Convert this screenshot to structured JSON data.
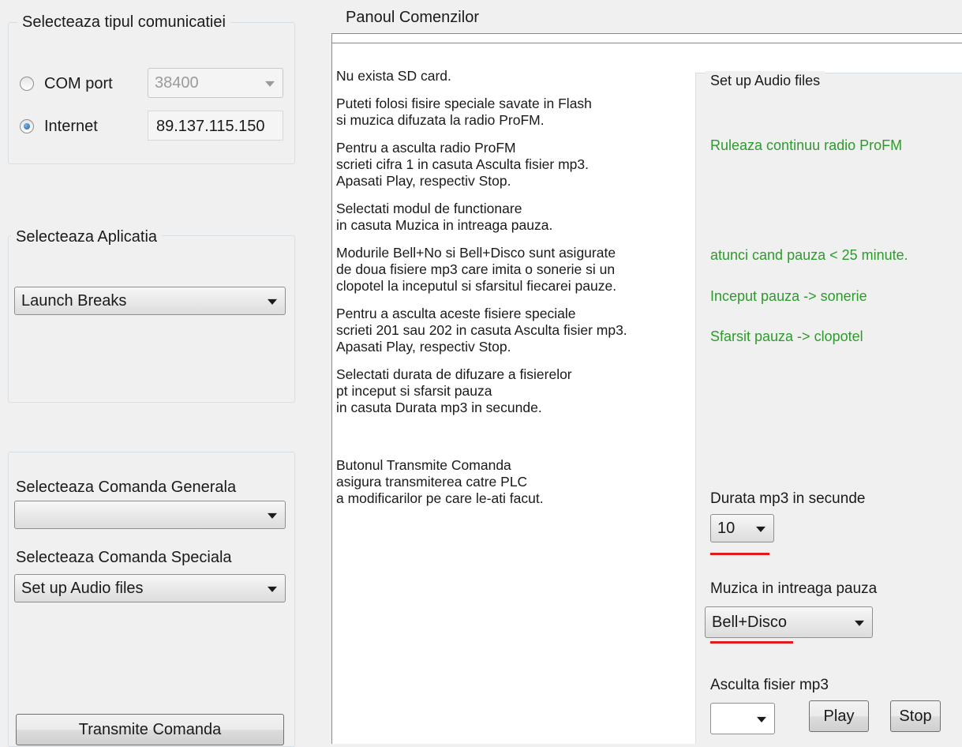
{
  "communication": {
    "title": "Selecteaza tipul comunicatiei",
    "com_port_label": "COM port",
    "com_port_value": "38400",
    "internet_label": "Internet",
    "internet_value": "89.137.115.150",
    "selected": "Internet"
  },
  "application": {
    "title": "Selecteaza Aplicatia",
    "selected": "Launch Breaks"
  },
  "commands": {
    "general_label": "Selecteaza Comanda Generala",
    "general_selected": "",
    "special_label": "Selecteaza Comanda Speciala",
    "special_selected": "Set up Audio files",
    "transmit_button": "Transmite Comanda"
  },
  "panel": {
    "title": "Panoul Comenzilor",
    "instructions": [
      "Nu exista SD card.",
      "Puteti folosi fisire speciale savate in Flash\nsi muzica difuzata la radio ProFM.",
      "Pentru a asculta radio ProFM\nscrieti cifra 1 in casuta Asculta fisier mp3.\nApasati Play, respectiv Stop.",
      "Selectati modul de functionare\nin casuta Muzica in intreaga pauza.",
      "Modurile Bell+No si Bell+Disco sunt asigurate\nde doua fisiere mp3 care imita o sonerie si un\nclopotel la inceputul si sfarsitul fiecarei pauze.",
      "Pentru a asculta aceste fisiere speciale\nscrieti 201 sau 202 in casuta Asculta fisier mp3.\nApasati Play, respectiv Stop.",
      "Selectati durata de difuzare a fisierelor\npt inceput si sfarsit pauza\nin casuta Durata mp3 in secunde.",
      "Butonul Transmite Comanda\nasigura transmiterea catre PLC\na modificarilor pe care le-ati facut."
    ]
  },
  "audio": {
    "title": "Set up Audio files",
    "status_radio": "Ruleaza continuu radio ProFM",
    "status_pause": "atunci cand pauza  <  25 minute.",
    "status_start": "Inceput pauza -> sonerie",
    "status_end": "Sfarsit pauza -> clopotel",
    "duration_label": "Durata mp3 in secunde",
    "duration_value": "10",
    "music_label": "Muzica in intreaga pauza",
    "music_value": "Bell+Disco",
    "listen_label": "Asculta fisier mp3",
    "listen_value": "",
    "play_button": "Play",
    "stop_button": "Stop"
  },
  "colors": {
    "status_green": "#2e9a2e",
    "underline_red": "#e01b1b"
  }
}
